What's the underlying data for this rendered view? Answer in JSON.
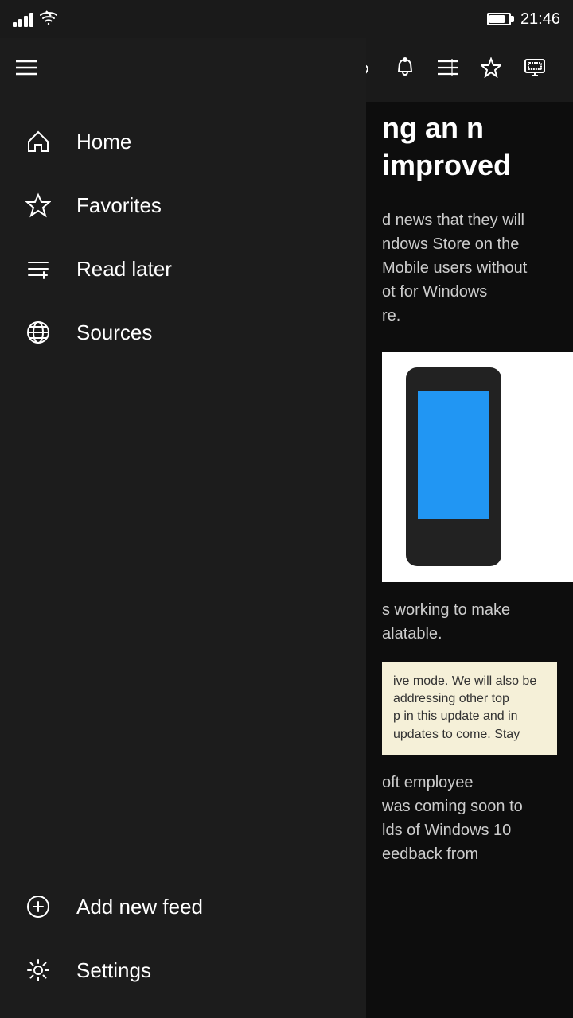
{
  "statusBar": {
    "time": "21:46"
  },
  "toolbar": {
    "hamburger_label": "☰",
    "link_label": "🔗",
    "notification_label": "🔔",
    "feed_label": "≡",
    "star_label": "☆",
    "cast_label": "⊡"
  },
  "sidebar": {
    "items": [
      {
        "id": "home",
        "label": "Home",
        "icon": "home-icon"
      },
      {
        "id": "favorites",
        "label": "Favorites",
        "icon": "star-icon"
      },
      {
        "id": "read-later",
        "label": "Read later",
        "icon": "readlater-icon"
      },
      {
        "id": "sources",
        "label": "Sources",
        "icon": "globe-icon"
      }
    ],
    "bottom_items": [
      {
        "id": "add-feed",
        "label": "Add new feed",
        "icon": "add-feed-icon"
      },
      {
        "id": "settings",
        "label": "Settings",
        "icon": "settings-icon"
      }
    ]
  },
  "content": {
    "heading_partial": "ng an\nn improved",
    "body_partial": "d news that they will\nndows Store on the\nMobile users without\not for Windows\nre.",
    "snippet_text": "ive mode. We will also be addressing other top\np in this update and in updates to come. Stay",
    "body2": "oft employee\nwas coming soon to\nlds of Windows 10\needback from"
  }
}
